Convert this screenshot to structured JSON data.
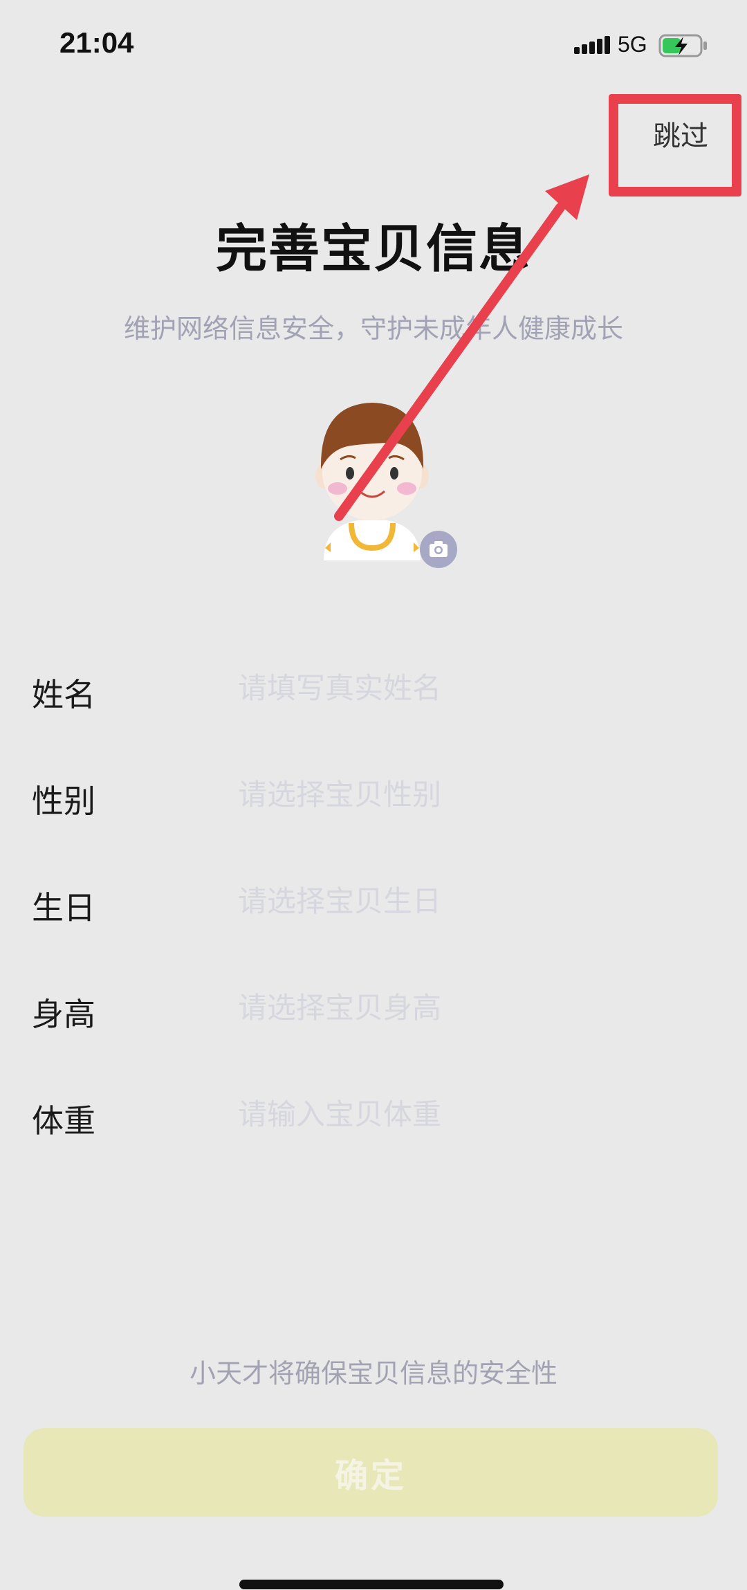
{
  "status_bar": {
    "time": "21:04",
    "network": "5G",
    "signal_icon": "signal-bars-icon",
    "battery_icon": "battery-charging-icon"
  },
  "header": {
    "skip_label": "跳过"
  },
  "title": "完善宝贝信息",
  "subtitle": "维护网络信息安全，守护未成年人健康成长",
  "avatar": {
    "icon": "child-avatar-icon",
    "camera_icon": "camera-icon"
  },
  "form": {
    "fields": [
      {
        "label": "姓名",
        "placeholder": "请填写真实姓名",
        "value": ""
      },
      {
        "label": "性别",
        "placeholder": "请选择宝贝性别",
        "value": ""
      },
      {
        "label": "生日",
        "placeholder": "请选择宝贝生日",
        "value": ""
      },
      {
        "label": "身高",
        "placeholder": "请选择宝贝身高",
        "value": ""
      },
      {
        "label": "体重",
        "placeholder": "请输入宝贝体重",
        "value": ""
      }
    ]
  },
  "footer": {
    "safety_note": "小天才将确保宝贝信息的安全性",
    "confirm_label": "确定"
  },
  "colors": {
    "background": "#e9e9e9",
    "annotation_red": "#e9404e",
    "confirm_button": "#e8e7b8",
    "subtitle_text": "#a2a2b5"
  }
}
